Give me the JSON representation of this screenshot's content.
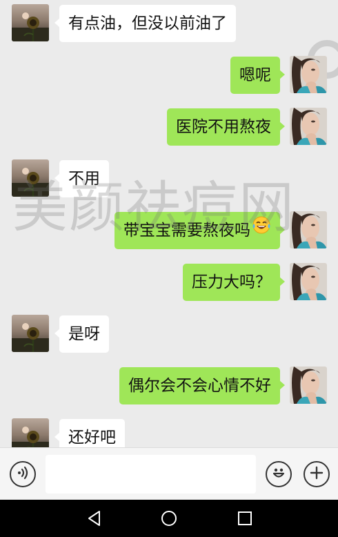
{
  "watermark": "美颜祛痘网",
  "messages": [
    {
      "side": "left",
      "text": "有点油，但没以前油了"
    },
    {
      "side": "right",
      "text": "嗯呢"
    },
    {
      "side": "right",
      "text": "医院不用熬夜"
    },
    {
      "side": "left",
      "text": "不用"
    },
    {
      "side": "right",
      "text": "带宝宝需要熬夜吗",
      "emoji": "tears-of-joy-emoji"
    },
    {
      "side": "right",
      "text": "压力大吗？"
    },
    {
      "side": "left",
      "text": "是呀"
    },
    {
      "side": "right",
      "text": "偶尔会不会心情不好"
    },
    {
      "side": "left",
      "text": "还好吧"
    }
  ],
  "input_bar": {
    "input_value": "",
    "left_icon": "voice-icon",
    "right_icons": [
      "emoji-icon",
      "plus-icon"
    ]
  },
  "nav": {
    "icons": [
      "back-icon",
      "home-icon",
      "recent-apps-icon"
    ]
  },
  "colors": {
    "chat_background": "#ebebeb",
    "sent_bubble": "#9fe658",
    "received_bubble": "#ffffff",
    "nav_bar": "#000000"
  }
}
